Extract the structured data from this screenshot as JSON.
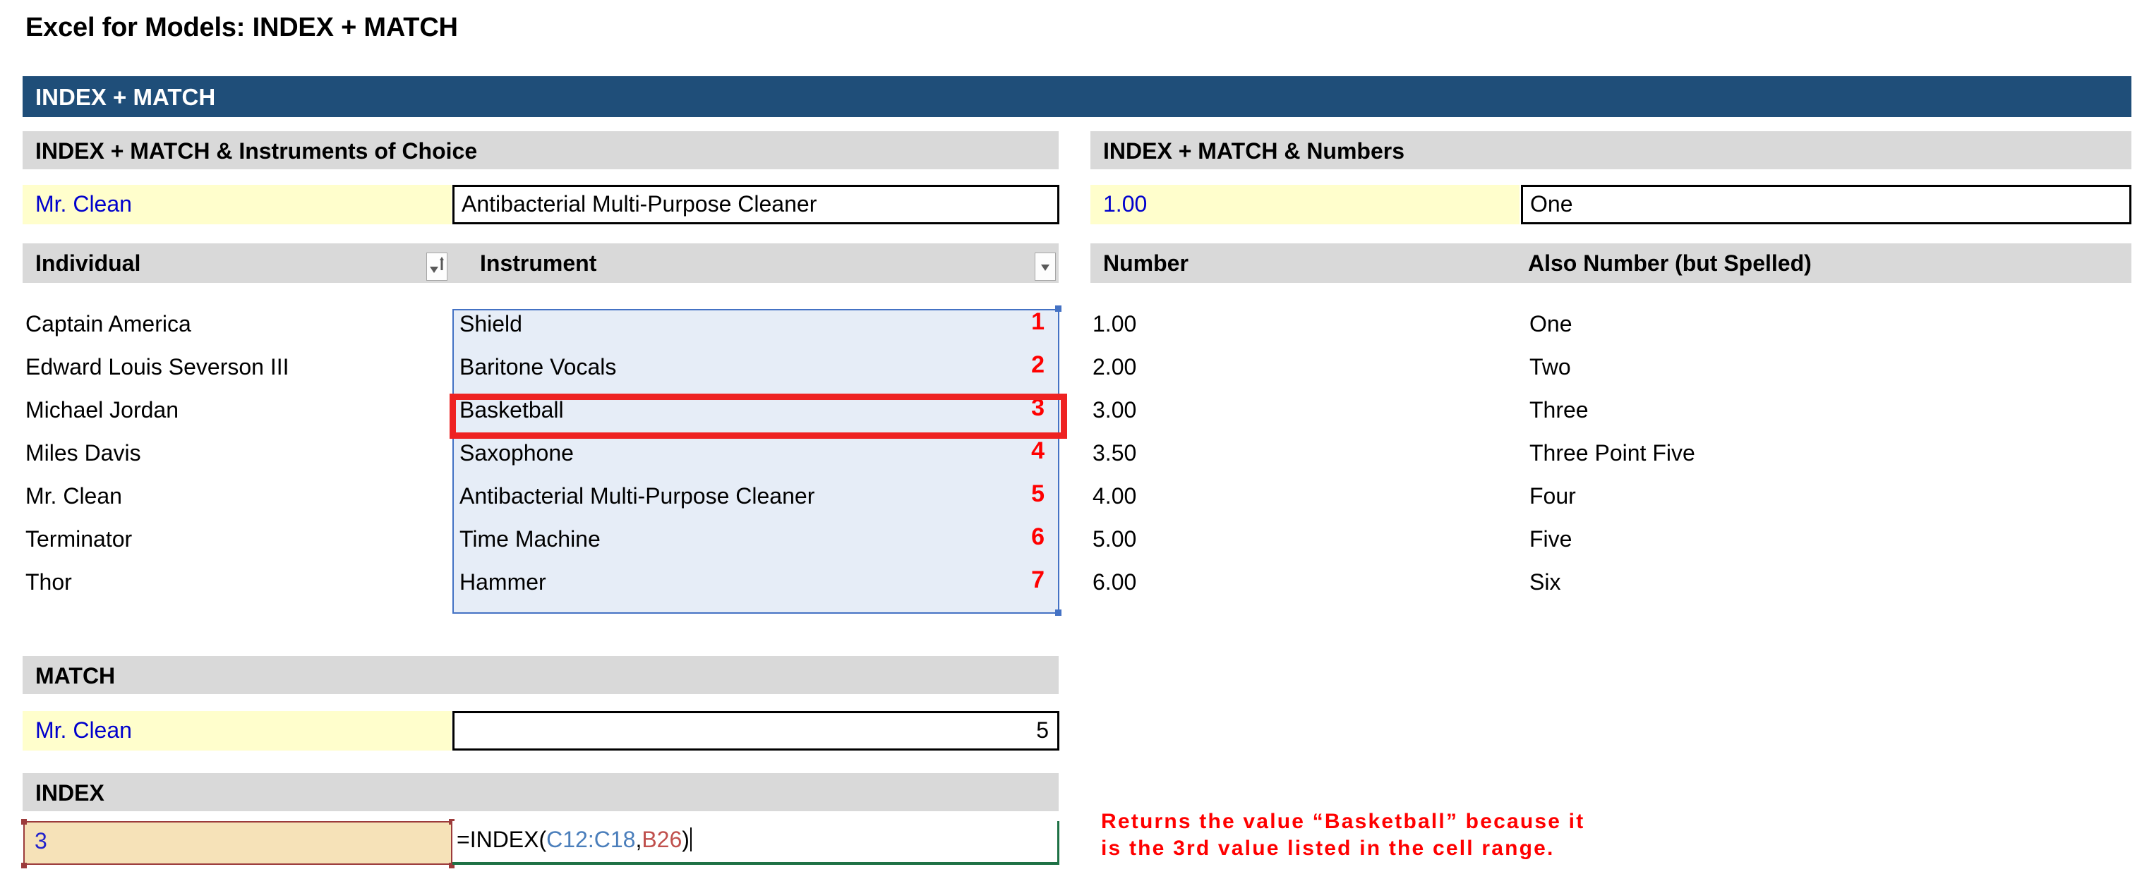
{
  "page_title": "Excel for Models: INDEX + MATCH",
  "banner": {
    "label": "INDEX + MATCH",
    "color": "#1f4e79"
  },
  "left_panel": {
    "section_title": "INDEX + MATCH & Instruments of Choice",
    "lookup_row": {
      "key_value": "Mr. Clean",
      "result_value": "Antibacterial Multi-Purpose Cleaner"
    },
    "table": {
      "headers": [
        "Individual",
        "Instrument"
      ],
      "filter_icons": [
        "sort-filter-icon",
        "chevron-down-icon"
      ],
      "rows": [
        {
          "individual": "Captain America",
          "instrument": "Shield",
          "position": "1"
        },
        {
          "individual": "Edward Louis Severson III",
          "instrument": "Baritone Vocals",
          "position": "2"
        },
        {
          "individual": "Michael Jordan",
          "instrument": "Basketball",
          "position": "3"
        },
        {
          "individual": "Miles Davis",
          "instrument": "Saxophone",
          "position": "4"
        },
        {
          "individual": "Mr. Clean",
          "instrument": "Antibacterial Multi-Purpose Cleaner",
          "position": "5"
        },
        {
          "individual": "Terminator",
          "instrument": "Time Machine",
          "position": "6"
        },
        {
          "individual": "Thor",
          "instrument": "Hammer",
          "position": "7"
        }
      ],
      "highlighted_row_index": 2,
      "selection_color": "#4472c4",
      "selection_fill": "#e6edf7",
      "highlight_color": "#ee2222"
    }
  },
  "right_panel": {
    "section_title": "INDEX + MATCH & Numbers",
    "lookup_row": {
      "key_value": "1.00",
      "result_value": "One"
    },
    "table": {
      "headers": [
        "Number",
        "Also Number (but Spelled)"
      ],
      "rows": [
        {
          "number": "1.00",
          "spelled": "One"
        },
        {
          "number": "2.00",
          "spelled": "Two"
        },
        {
          "number": "3.00",
          "spelled": "Three"
        },
        {
          "number": "3.50",
          "spelled": "Three Point Five"
        },
        {
          "number": "4.00",
          "spelled": "Four"
        },
        {
          "number": "5.00",
          "spelled": "Five"
        },
        {
          "number": "6.00",
          "spelled": "Six"
        }
      ]
    }
  },
  "match_section": {
    "section_title": "MATCH",
    "key_value": "Mr. Clean",
    "result_value": "5"
  },
  "index_section": {
    "section_title": "INDEX",
    "arg_value": "3",
    "formula": {
      "prefix": "=INDEX(",
      "range_ref": "C12:C18",
      "comma": ",",
      "index_ref": "B26",
      "suffix": ")",
      "range_ref_color": "#4a7ebb",
      "index_ref_color": "#c0504d"
    }
  },
  "annotation": {
    "text": "Returns the value “Basketball” because it\nis the 3rd value listed in the cell range.",
    "color": "#ff0000"
  }
}
